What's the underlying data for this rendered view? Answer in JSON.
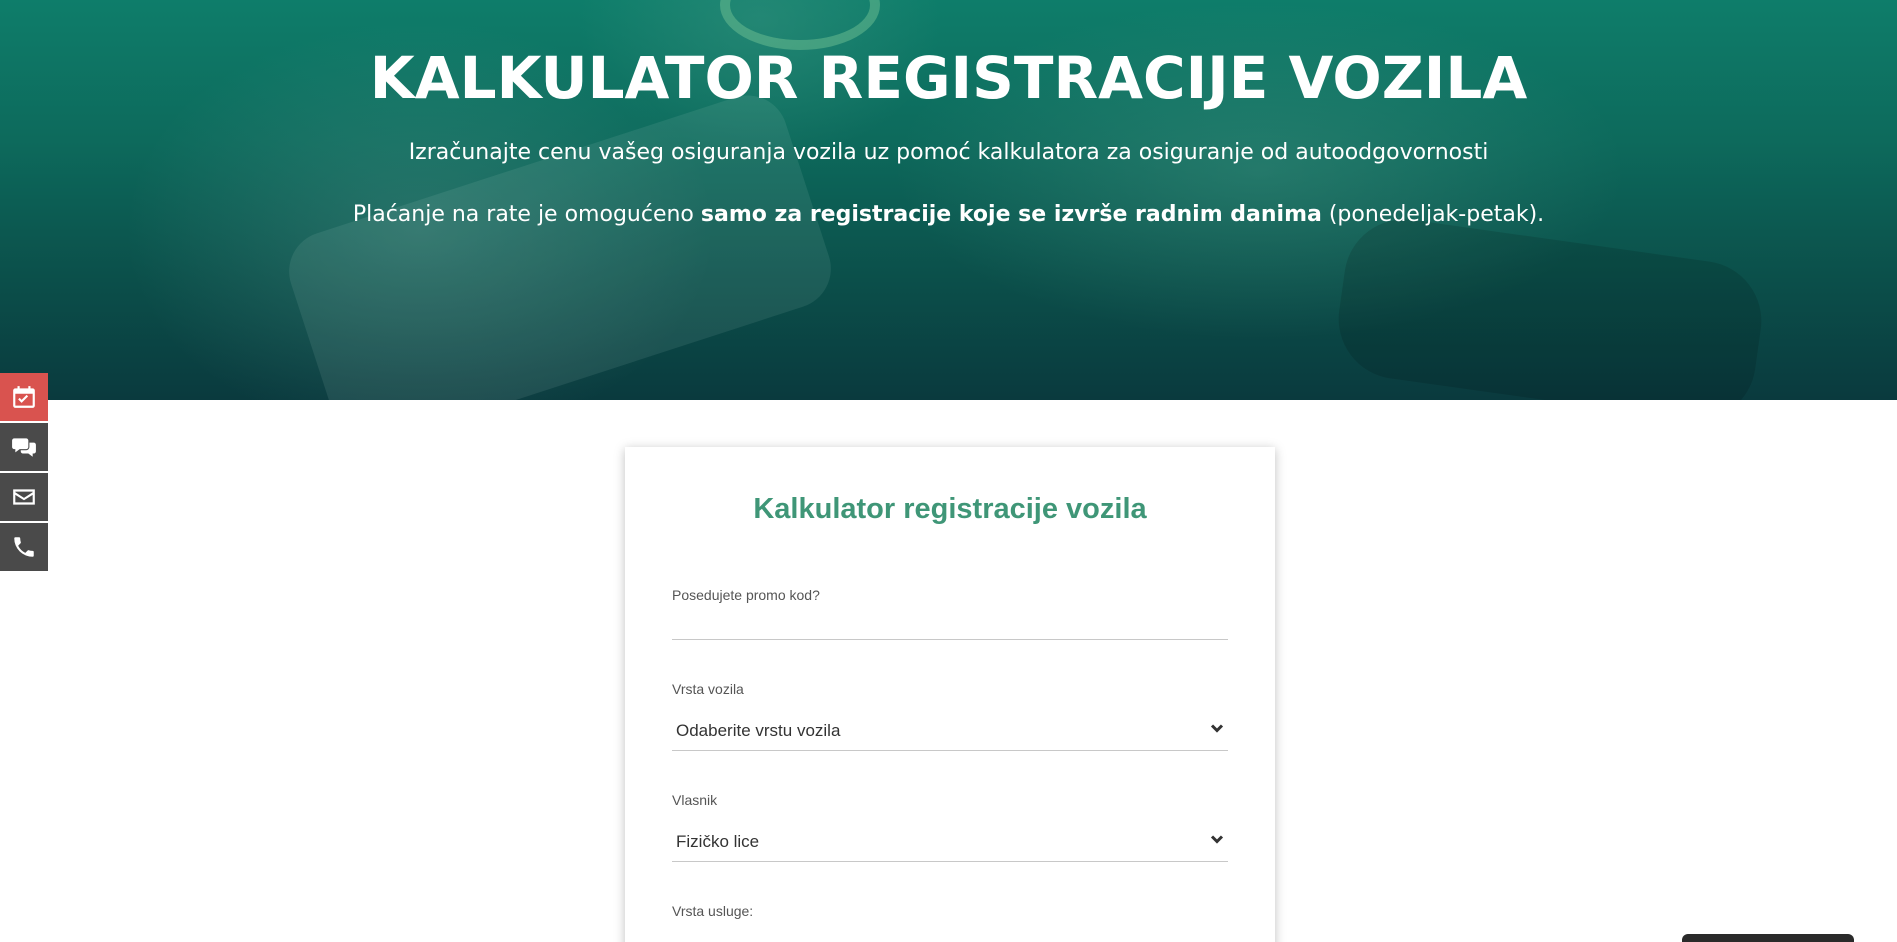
{
  "hero": {
    "title": "KALKULATOR REGISTRACIJE VOZILA",
    "subtitle": "Izračunajte cenu vašeg osiguranja vozila uz pomoć kalkulatora za osiguranje od autoodgovornosti",
    "note_pre": "Plaćanje na rate je omogućeno ",
    "note_bold": "samo za registracije koje se izvrše radnim danima",
    "note_post": " (ponedeljak-petak)."
  },
  "side_actions": [
    {
      "icon": "calendar-check-icon",
      "color": "#d9534f"
    },
    {
      "icon": "chat-icon",
      "color": "#4a4a4a"
    },
    {
      "icon": "mail-icon",
      "color": "#4a4a4a"
    },
    {
      "icon": "phone-icon",
      "color": "#4a4a4a"
    }
  ],
  "form": {
    "title": "Kalkulator registracije vozila",
    "promo_label": "Posedujete promo kod?",
    "promo_value": "",
    "vehicle_type_label": "Vrsta vozila",
    "vehicle_type_value": "Odaberite vrstu vozila",
    "owner_label": "Vlasnik",
    "owner_value": "Fizičko lice",
    "service_label": "Vrsta usluge:"
  },
  "colors": {
    "accent": "#3f9677",
    "hero_dark": "#0a3a3e",
    "hero_light": "#0e7d6a",
    "side_red": "#d9534f",
    "side_gray": "#4a4a4a"
  }
}
